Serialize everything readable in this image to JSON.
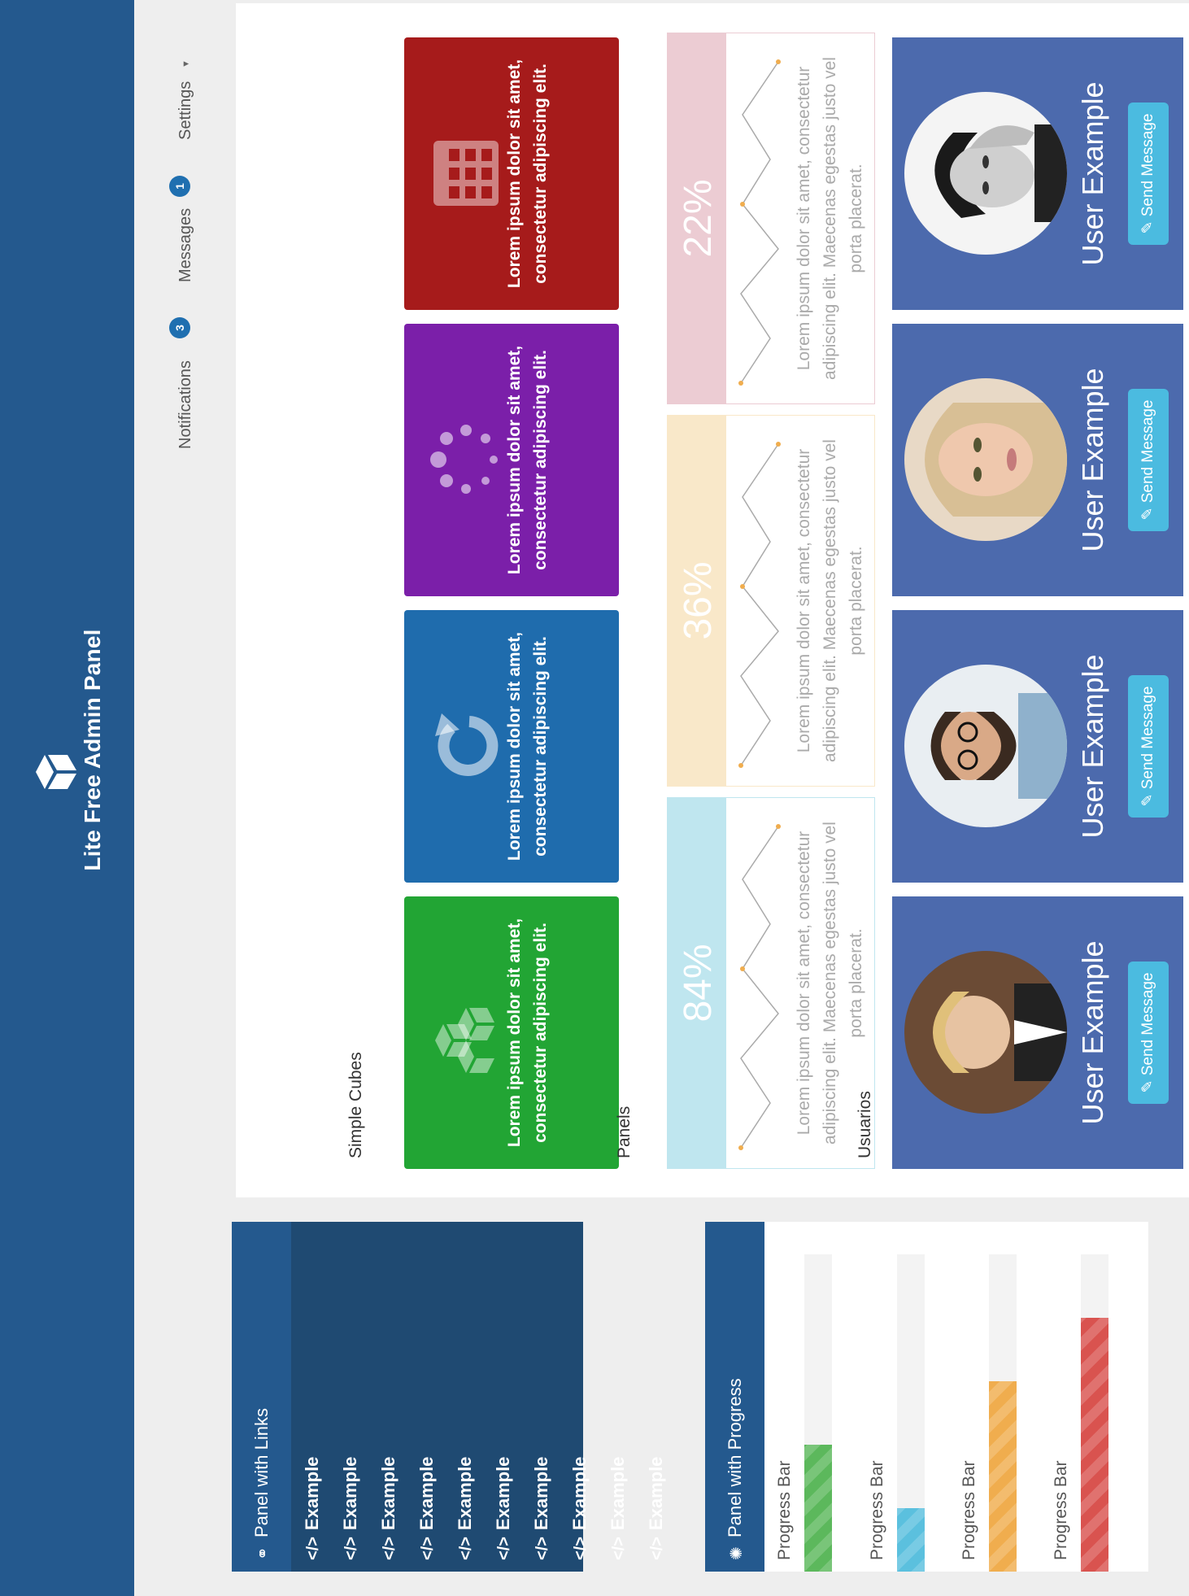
{
  "app": {
    "title": "Lite Free Admin Panel"
  },
  "topbar": {
    "notifications": {
      "label": "Notifications",
      "count": "3"
    },
    "messages": {
      "label": "Messages",
      "count": "1"
    },
    "settings": {
      "label": "Settings"
    }
  },
  "links_panel": {
    "title": "Panel with Links",
    "items": [
      "Example",
      "Example",
      "Example",
      "Example",
      "Example",
      "Example",
      "Example",
      "Example",
      "Example",
      "Example"
    ]
  },
  "progress_panel": {
    "title": "Panel with Progress",
    "bars": [
      {
        "label": "Progress Bar",
        "value": 0.4,
        "color": "#5cb85c"
      },
      {
        "label": "Progress Bar",
        "value": 0.2,
        "color": "#5bc0de"
      },
      {
        "label": "Progress Bar",
        "value": 0.6,
        "color": "#f0ad4e"
      },
      {
        "label": "Progress Bar",
        "value": 0.8,
        "color": "#d9534f"
      }
    ]
  },
  "simple_cubes": {
    "title": "Simple Cubes",
    "cubes": [
      {
        "text": "Lorem ipsum dolor sit amet, consectetur adipiscing elit.",
        "color": "#22a534",
        "icon": "cubes-icon"
      },
      {
        "text": "Lorem ipsum dolor sit amet, consectetur adipiscing elit.",
        "color": "#1f6cad",
        "icon": "refresh-icon"
      },
      {
        "text": "Lorem ipsum dolor sit amet, consectetur adipiscing elit.",
        "color": "#7b1fa9",
        "icon": "spinner-icon"
      },
      {
        "text": "Lorem ipsum dolor sit amet, consectetur adipiscing elit.",
        "color": "#a61b1b",
        "icon": "grid-icon"
      }
    ]
  },
  "panels": {
    "title": "Panels",
    "items": [
      {
        "percent": "84%",
        "text": "Lorem ipsum dolor sit amet, consectetur adipiscing elit. Maecenas egestas justo vel porta placerat.",
        "color": "#bfe6ef"
      },
      {
        "percent": "36%",
        "text": "Lorem ipsum dolor sit amet, consectetur adipiscing elit. Maecenas egestas justo vel porta placerat.",
        "color": "#f9e8c9"
      },
      {
        "percent": "22%",
        "text": "Lorem ipsum dolor sit amet, consectetur adipiscing elit. Maecenas egestas justo vel porta placerat.",
        "color": "#ecccd3"
      }
    ]
  },
  "users": {
    "title": "Usuarios",
    "cards": [
      {
        "name": "User Example",
        "button": "Send Message"
      },
      {
        "name": "User Example",
        "button": "Send Message"
      },
      {
        "name": "User Example",
        "button": "Send Message"
      },
      {
        "name": "User Example",
        "button": "Send Message"
      }
    ]
  }
}
